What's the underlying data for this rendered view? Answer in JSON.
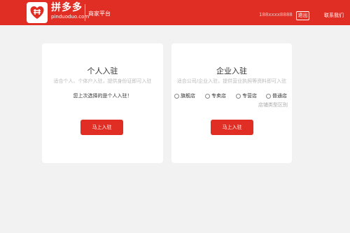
{
  "header": {
    "logo_cn": "拼多多",
    "logo_en": "pinduoduo.com",
    "subtitle": "商家平台",
    "user_name": "188xxxx8888",
    "logout_label": "退出",
    "contact_label": "联系我们",
    "bar_color": "#e02e24"
  },
  "personal": {
    "title": "个人入驻",
    "description": "适合个人、个体户入驻，提供身份证即可入驻",
    "last_choice": "您上次选择的是个人入驻！",
    "button_label": "马上入驻"
  },
  "enterprise": {
    "title": "企业入驻",
    "description": "适合公司/企业入驻，提供营业执照等资料即可入驻",
    "store_types": [
      "旗舰店",
      "专卖店",
      "专营店",
      "普通店"
    ],
    "store_diff_link": "店铺类型区别",
    "button_label": "马上入驻"
  },
  "icons": {
    "logo": "pinduoduo-logo-icon"
  }
}
